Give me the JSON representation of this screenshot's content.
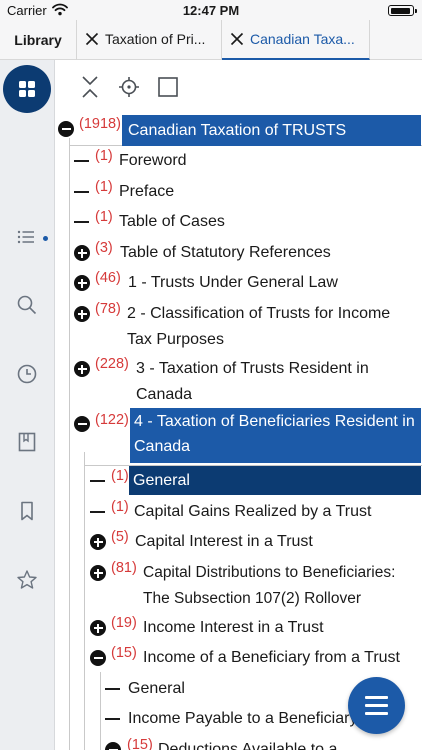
{
  "status_bar": {
    "carrier": "Carrier",
    "time": "12:47 PM",
    "battery_level": 0.95
  },
  "tab_bar": {
    "library_label": "Library",
    "tabs": [
      {
        "label": "Taxation of Pri...",
        "active": false
      },
      {
        "label": "Canadian Taxa...",
        "active": true
      }
    ]
  },
  "rail": {
    "items": [
      "home-grid-icon",
      "table-of-contents-icon",
      "search-icon",
      "history-icon",
      "book-icon",
      "bookmark-icon",
      "favorite-star-icon"
    ],
    "active_indicator": "table-of-contents-icon"
  },
  "toolbar": {
    "buttons": [
      "collapse-all-icon",
      "locate-icon",
      "select-checkbox-icon"
    ]
  },
  "tree": {
    "root": {
      "count": "(1918)",
      "title": "Canadian Taxation of TRUSTS",
      "state": "expanded"
    },
    "items": [
      {
        "count": "(1)",
        "title": "Foreword",
        "state": "leaf"
      },
      {
        "count": "(1)",
        "title": "Preface",
        "state": "leaf"
      },
      {
        "count": "(1)",
        "title": "Table of Cases",
        "state": "leaf"
      },
      {
        "count": "(3)",
        "title": "Table of Statutory References",
        "state": "collapsed"
      },
      {
        "count": "(46)",
        "title": "1 - Trusts Under General Law",
        "state": "collapsed"
      },
      {
        "count": "(78)",
        "title": "2 - Classification of Trusts for Income Tax Purposes",
        "state": "collapsed"
      },
      {
        "count": "(228)",
        "title": "3 - Taxation of Trusts Resident in Canada",
        "state": "collapsed"
      },
      {
        "count": "(122)",
        "title": "4 - Taxation of Beneficiaries Resident in Canada",
        "state": "expanded"
      }
    ],
    "chapter4_items": [
      {
        "count": "(1)",
        "title": "General",
        "state": "leaf"
      },
      {
        "count": "(1)",
        "title": "Capital Gains Realized by a Trust",
        "state": "leaf"
      },
      {
        "count": "(5)",
        "title": "Capital Interest in a Trust",
        "state": "collapsed"
      },
      {
        "count": "(81)",
        "title": "Capital Distributions to Beneficiaries: The Subsection 107(2) Rollover",
        "state": "collapsed"
      },
      {
        "count": "(19)",
        "title": "Income Interest in a Trust",
        "state": "collapsed"
      },
      {
        "count": "(15)",
        "title": "Income of a Beneficiary from a Trust",
        "state": "expanded"
      }
    ],
    "income_items": [
      {
        "title": "General",
        "state": "leaf"
      },
      {
        "title": "Income Payable to a Beneficiary",
        "state": "leaf"
      },
      {
        "count": "(15)",
        "title": "Deductions Available to a",
        "state": "expanded"
      }
    ]
  },
  "fab": {
    "icon": "menu-icon"
  },
  "colors": {
    "accent": "#1c5aa8",
    "accent_dark": "#0c3b72",
    "count": "#d63a3a",
    "rail_bg": "#eceef1"
  }
}
